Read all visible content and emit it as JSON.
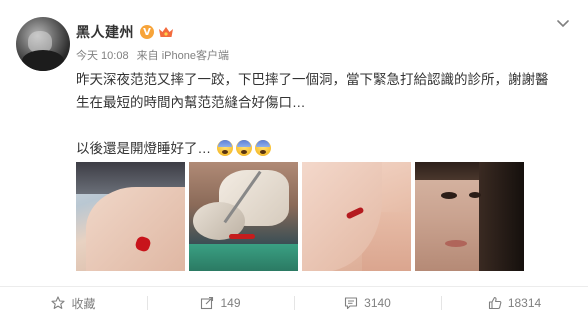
{
  "post": {
    "author": "黑人建州",
    "verified_badge": "V",
    "time": "今天 10:08",
    "source": "来自 iPhone客户端",
    "text_line1": "昨天深夜范范又摔了一跤，下巴摔了一個洞，當下緊急打給認識的診所，謝謝醫",
    "text_line2": "生在最短的時間內幫范范縫合好傷口…",
    "text_line3": "以後還是開燈睡好了…"
  },
  "actions": {
    "favorite_label": "收藏",
    "repost_count": "149",
    "comment_count": "3140",
    "like_count": "18314"
  },
  "colors": {
    "accent_badge": "#f7a43a",
    "text": "#333333",
    "meta": "#808080"
  }
}
